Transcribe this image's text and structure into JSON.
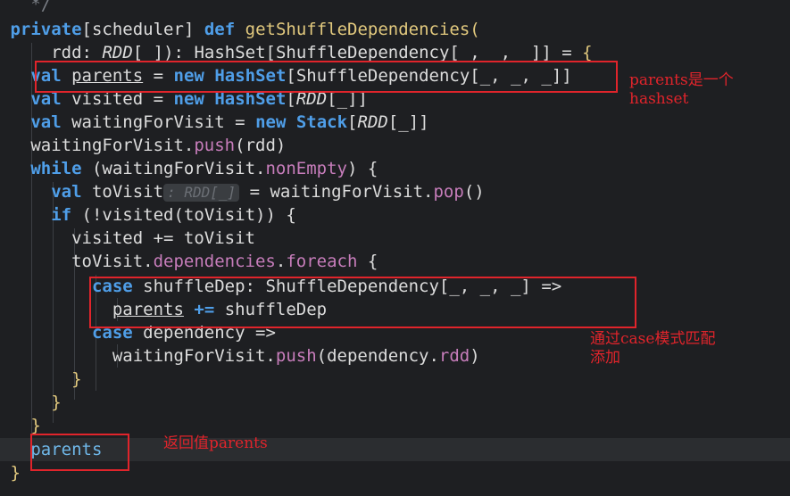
{
  "code": {
    "comment_tail": "*/",
    "line1": {
      "kw_private": "private",
      "scope_open": "[",
      "scope": "scheduler",
      "scope_close": "]",
      "kw_def": "def",
      "name": "getShuffleDependencies",
      "paren": "("
    },
    "line2": {
      "param": "rdd",
      "colon": ":",
      "rdd_type": "RDD",
      "rdd_args": "[_]",
      "close": "):",
      "ret_type": "HashSet[ShuffleDependency[_, _, _]]",
      "eq": "=",
      "brace": "{"
    },
    "line3": {
      "kw_val": "val",
      "name": "parents",
      "eq": "=",
      "kw_new": "new",
      "type": "HashSet",
      "args": "[ShuffleDependency[_, _, _]]"
    },
    "line4": {
      "kw_val": "val",
      "name": "visited",
      "eq": "=",
      "kw_new": "new",
      "type": "HashSet",
      "open": "[",
      "rdd": "RDD",
      "args": "[_]]"
    },
    "line5": {
      "kw_val": "val",
      "name": "waitingForVisit",
      "eq": "=",
      "kw_new": "new",
      "type": "Stack",
      "open": "[",
      "rdd": "RDD",
      "args": "[_]]"
    },
    "line6": {
      "obj": "waitingForVisit.",
      "method": "push",
      "args": "(rdd)"
    },
    "line7": {
      "kw_while": "while",
      "open": "(waitingForVisit.",
      "method": "nonEmpty",
      "close": ") {"
    },
    "line8": {
      "kw_val": "val",
      "name": "toVisit",
      "hint": ": RDD[_]",
      "eq": "= waitingForVisit.",
      "method": "pop",
      "args": "()"
    },
    "line9": {
      "kw_if": "if",
      "cond": "(!visited(toVisit)) {"
    },
    "line10": {
      "text": "visited += toVisit"
    },
    "line11": {
      "obj": "toVisit.",
      "deps": "dependencies",
      "dot": ".",
      "foreach": "foreach",
      "brace": "{"
    },
    "line12": {
      "kw_case": "case",
      "pattern": "shuffleDep: ShuffleDependency[_, _, _]",
      "arrow": "=>"
    },
    "line13": {
      "name": "parents",
      "op": "+=",
      "rest": "shuffleDep"
    },
    "line14": {
      "kw_case": "case",
      "pattern": "dependency",
      "arrow": "=>"
    },
    "line15": {
      "obj": "waitingForVisit.",
      "method": "push",
      "args": "(dependency.",
      "rdd": "rdd",
      "close": ")"
    },
    "line16": {
      "brace": "}"
    },
    "line17": {
      "brace": "}"
    },
    "line18": {
      "brace": "}"
    },
    "line19": {
      "name": "parents"
    },
    "line20": {
      "brace": "}"
    }
  },
  "annotations": {
    "parents_note": "parents是一个\nhashset",
    "case_note": "通过case模式匹配\n添加",
    "return_note": "返回值parents"
  },
  "colors": {
    "background": "#1e1f22",
    "keyword": "#4f9ee8",
    "function": "#e2c97e",
    "annotation_red": "#e0242b"
  }
}
